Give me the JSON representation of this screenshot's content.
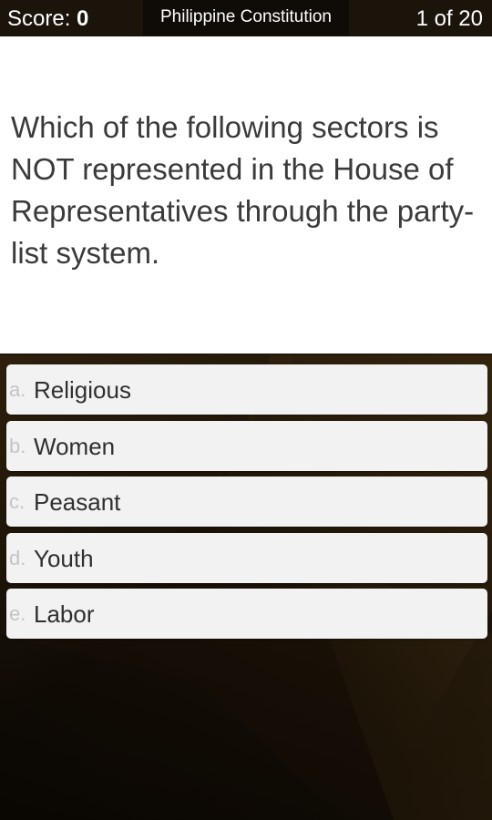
{
  "header": {
    "score_label": "Score:",
    "score_value": "0",
    "title": "Philippine Constitution",
    "progress": "1 of 20"
  },
  "question": {
    "text": "Which of the following sectors is NOT represented in the House of Representatives through the party-list system."
  },
  "options": [
    {
      "letter": "a.",
      "label": "Religious"
    },
    {
      "letter": "b.",
      "label": "Women"
    },
    {
      "letter": "c.",
      "label": "Peasant"
    },
    {
      "letter": "d.",
      "label": "Youth"
    },
    {
      "letter": "e.",
      "label": "Labor"
    }
  ],
  "colors": {
    "header_bg": "#1b140a",
    "title_bg": "#0f0b06",
    "option_bg": "#f2f2f2",
    "background": "#24180a"
  }
}
